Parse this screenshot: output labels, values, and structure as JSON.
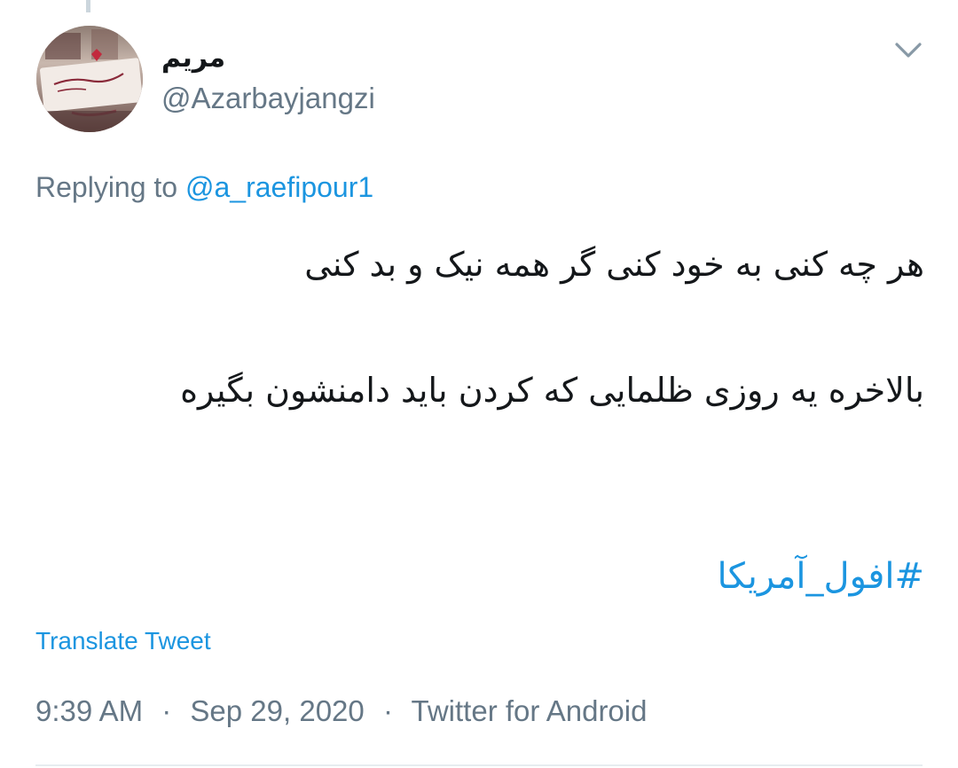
{
  "author": {
    "display_name": "مریم",
    "handle": "@Azarbayjangzi"
  },
  "reply": {
    "prefix": "Replying to",
    "to_handle": "@a_raefipour1"
  },
  "tweet": {
    "line1": "هر چه کنی به خود کنی گر همه نیک و بد کنی",
    "line2": "بالاخره یه روزی ظلمایی که کردن باید دامنشون بگیره",
    "hashtag": "#افول_آمریکا"
  },
  "actions": {
    "translate": "Translate Tweet"
  },
  "meta": {
    "time": "9:39 AM",
    "date": "Sep 29, 2020",
    "source": "Twitter for Android",
    "separator": "·"
  },
  "colors": {
    "link": "#1b95e0",
    "secondary": "#657786",
    "text": "#14171a"
  },
  "icons": {
    "caret": "chevron-down-icon"
  }
}
